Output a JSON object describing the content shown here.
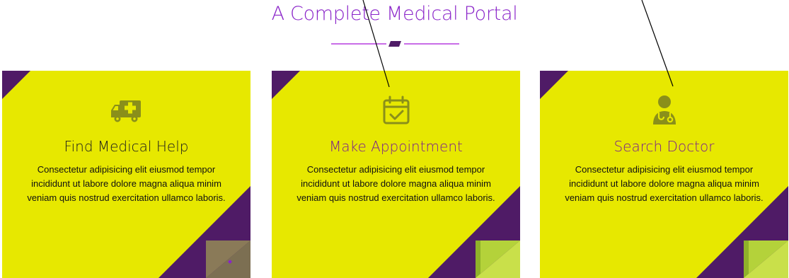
{
  "section": {
    "title": "A Complete Medical Portal"
  },
  "colors": {
    "card_background": "#e7e800",
    "accent_purple": "#4f1b66",
    "title_purple": "#8a24c9",
    "divider_line": "#c86de8",
    "fold_green": "#b4d23a",
    "fold_olive": "#8a7a58"
  },
  "cards": [
    {
      "title": "Find Medical Help",
      "text": "Consectetur adipisicing elit eiusmod tempor incididunt ut labore dolore magna aliqua minim veniam quis nostrud exercitation ullamco laboris.",
      "icon": "ambulance-icon"
    },
    {
      "title": "Make Appointment",
      "text": "Consectetur adipisicing elit eiusmod tempor incididunt ut labore dolore magna aliqua minim veniam quis nostrud exercitation ullamco laboris.",
      "icon": "calendar-check-icon"
    },
    {
      "title": "Search Doctor",
      "text": "Consectetur adipisicing elit eiusmod tempor incididunt ut labore dolore magna aliqua minim veniam quis nostrud exercitation ullamco laboris.",
      "icon": "doctor-icon"
    }
  ]
}
